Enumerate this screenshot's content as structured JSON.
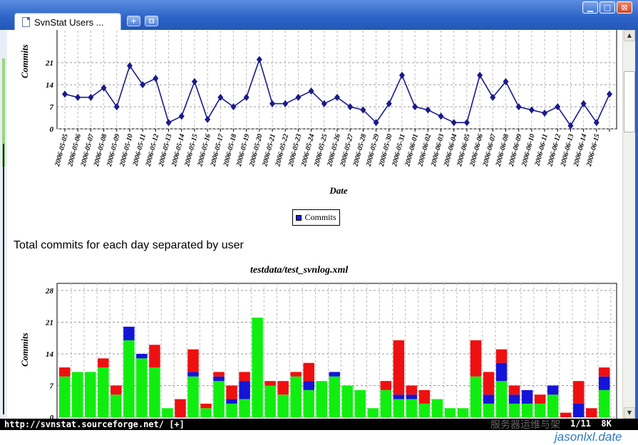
{
  "window": {
    "tab_title": "SvnStat Users ...",
    "new_tab_glyph": "+",
    "tab_list_glyph": "⧉",
    "minimize_glyph": "▁",
    "maximize_glyph": "□",
    "close_glyph": "⊠"
  },
  "status_bar": {
    "url": "http://svnstat.sourceforge.net/ [+]",
    "page_counter": "1/11",
    "extra": "8K"
  },
  "watermark": {
    "cn_text": "服务器运维与架",
    "url_text": "jasonlxl.date"
  },
  "section_heading": "Total commits for each day separated by user",
  "legend": {
    "label": "Commits"
  },
  "colors": {
    "line": "#1a1a8c",
    "green": "#10ee10",
    "blue": "#1414d8",
    "red": "#ee1010"
  },
  "chart_data": [
    {
      "type": "line",
      "xlabel": "Date",
      "ylabel": "Commits",
      "ylim": [
        0,
        21
      ],
      "yticks": [
        0,
        7,
        14,
        21
      ],
      "yticks_visible": [
        "0",
        "7",
        "14",
        "21"
      ],
      "grid": true,
      "legend": "bottom-center",
      "x": [
        "2006-05-05",
        "2006-05-06",
        "2006-05-07",
        "2006-05-08",
        "2006-05-09",
        "2006-05-10",
        "2006-05-11",
        "2006-05-12",
        "2006-05-13",
        "2006-05-14",
        "2006-05-15",
        "2006-05-16",
        "2006-05-17",
        "2006-05-18",
        "2006-05-19",
        "2006-05-20",
        "2006-05-21",
        "2006-05-22",
        "2006-05-23",
        "2006-05-24",
        "2006-05-25",
        "2006-05-26",
        "2006-05-27",
        "2006-05-28",
        "2006-05-29",
        "2006-05-30",
        "2006-05-31",
        "2006-06-01",
        "2006-06-02",
        "2006-06-03",
        "2006-06-04",
        "2006-06-05",
        "2006-06-06",
        "2006-06-07",
        "2006-06-08",
        "2006-06-09",
        "2006-06-10",
        "2006-06-11",
        "2006-06-12",
        "2006-06-13",
        "2006-06-14",
        "2006-06-15"
      ],
      "series": [
        {
          "name": "Commits",
          "values": [
            11,
            10,
            10,
            13,
            7,
            20,
            14,
            16,
            2,
            4,
            15,
            3,
            10,
            7,
            10,
            22,
            8,
            8,
            10,
            12,
            8,
            10,
            7,
            6,
            2,
            8,
            17,
            7,
            6,
            4,
            2,
            2,
            17,
            10,
            15,
            7,
            6,
            5,
            7,
            1,
            8,
            2,
            11
          ]
        }
      ]
    },
    {
      "type": "bar",
      "title": "testdata/test_svnlog.xml",
      "ylabel": "Commits",
      "ylim": [
        0,
        28
      ],
      "yticks": [
        "0",
        "7",
        "14",
        "21",
        "28"
      ],
      "grid": true,
      "stacked": true,
      "series": [
        {
          "name": "",
          "color": "green",
          "values": [
            9,
            10,
            10,
            11,
            5,
            17,
            13,
            11,
            2,
            0,
            9,
            2,
            8,
            3,
            4,
            22,
            7,
            5,
            9,
            6,
            8,
            9,
            7,
            6,
            2,
            6,
            4,
            4,
            3,
            4,
            2,
            2,
            9,
            3,
            8,
            3,
            3,
            3,
            5,
            0,
            0,
            0,
            6
          ]
        },
        {
          "name": "",
          "color": "blue",
          "values": [
            0,
            0,
            0,
            0,
            0,
            3,
            1,
            0,
            0,
            0,
            1,
            0,
            1,
            1,
            4,
            0,
            0,
            0,
            0,
            2,
            0,
            1,
            0,
            0,
            0,
            0,
            1,
            1,
            0,
            0,
            0,
            0,
            0,
            2,
            4,
            2,
            3,
            0,
            2,
            0,
            3,
            0,
            3
          ]
        },
        {
          "name": "",
          "color": "red",
          "values": [
            2,
            0,
            0,
            2,
            2,
            0,
            0,
            5,
            0,
            4,
            5,
            1,
            1,
            3,
            2,
            0,
            1,
            3,
            1,
            4,
            0,
            0,
            0,
            0,
            0,
            2,
            12,
            2,
            3,
            0,
            0,
            0,
            8,
            5,
            3,
            2,
            0,
            2,
            0,
            1,
            5,
            2,
            2
          ]
        }
      ]
    }
  ]
}
